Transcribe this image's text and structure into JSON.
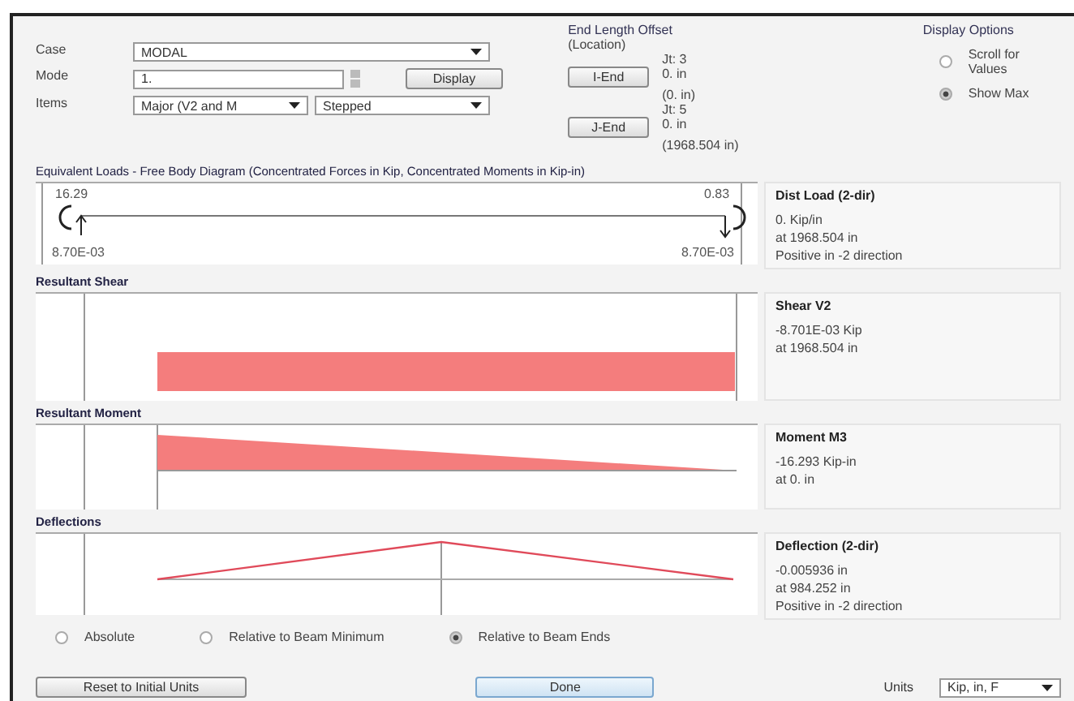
{
  "controls": {
    "case_label": "Case",
    "case_value": "MODAL",
    "mode_label": "Mode",
    "mode_value": "1.",
    "display_button": "Display",
    "items_label": "Items",
    "items_value": "Major (V2 and M",
    "items_style": "Stepped"
  },
  "end_length_offset": {
    "title": "End Length Offset",
    "subtitle": "(Location)",
    "ends": [
      {
        "joint": "Jt: 3",
        "button": "I-End",
        "offset": "0. in",
        "location": "(0. in)"
      },
      {
        "joint": "Jt: 5",
        "button": "J-End",
        "offset": "0. in",
        "location": "(1968.504 in)"
      }
    ]
  },
  "display_options": {
    "title": "Display Options",
    "options": [
      {
        "label": "Scroll for Values",
        "selected": false
      },
      {
        "label": "Show Max",
        "selected": true
      }
    ]
  },
  "sections": [
    {
      "kind": "fbd",
      "title": "Equivalent Loads - Free Body Diagram  (Concentrated Forces in Kip, Concentrated Moments in Kip-in)",
      "labels": [
        "16.29",
        "0.83",
        "8.70E-03",
        "8.70E-03"
      ],
      "info_title": "Dist Load (2-dir)",
      "info_lines": [
        "0. Kip/in",
        "at 1968.504 in",
        "Positive in -2 direction"
      ]
    },
    {
      "kind": "shear",
      "title": "Resultant Shear",
      "info_title": "Shear V2",
      "info_lines": [
        "-8.701E-03 Kip",
        "at 1968.504 in"
      ]
    },
    {
      "kind": "moment",
      "title": "Resultant Moment",
      "info_title": "Moment M3",
      "info_lines": [
        "-16.293 Kip-in",
        "at 0. in"
      ]
    },
    {
      "kind": "deflection",
      "title": "Deflections",
      "info_title": "Deflection (2-dir)",
      "info_lines": [
        "-0.005936 in",
        "at 984.252 in",
        "Positive in -2 direction"
      ]
    }
  ],
  "deflection_options": [
    {
      "label": "Absolute",
      "selected": false
    },
    {
      "label": "Relative to Beam Minimum",
      "selected": false
    },
    {
      "label": "Relative to Beam Ends",
      "selected": true
    }
  ],
  "buttons": {
    "reset": "Reset to Initial Units",
    "done": "Done",
    "units_label": "Units",
    "units_value": "Kip, in, F"
  }
}
